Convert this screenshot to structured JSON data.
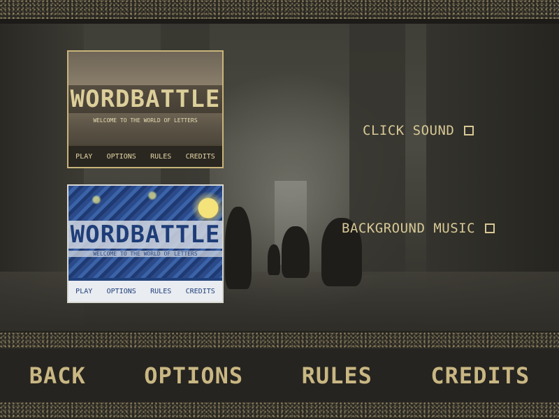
{
  "game": {
    "title": "WORDBATTLE",
    "tagline": "WELCOME TO THE WORLD OF LETTERS"
  },
  "theme_previews": [
    {
      "title": "WORDBATTLE",
      "tagline": "WELCOME TO THE WORLD OF LETTERS",
      "nav": [
        "PLAY",
        "OPTIONS",
        "RULES",
        "CREDITS"
      ]
    },
    {
      "title": "WORDBATTLE",
      "tagline": "WELCOME TO THE WORLD OF LETTERS",
      "nav": [
        "PLAY",
        "OPTIONS",
        "RULES",
        "CREDITS"
      ]
    }
  ],
  "options": {
    "click_sound": {
      "label": "CLICK SOUND",
      "checked": false
    },
    "background_music": {
      "label": "BACKGROUND MUSIC",
      "checked": false
    }
  },
  "bottom_nav": [
    "BACK",
    "OPTIONS",
    "RULES",
    "CREDITS"
  ],
  "colors": {
    "accent_text": "#c9b783",
    "band_dark": "#262420",
    "night_theme_text": "#20407a"
  }
}
